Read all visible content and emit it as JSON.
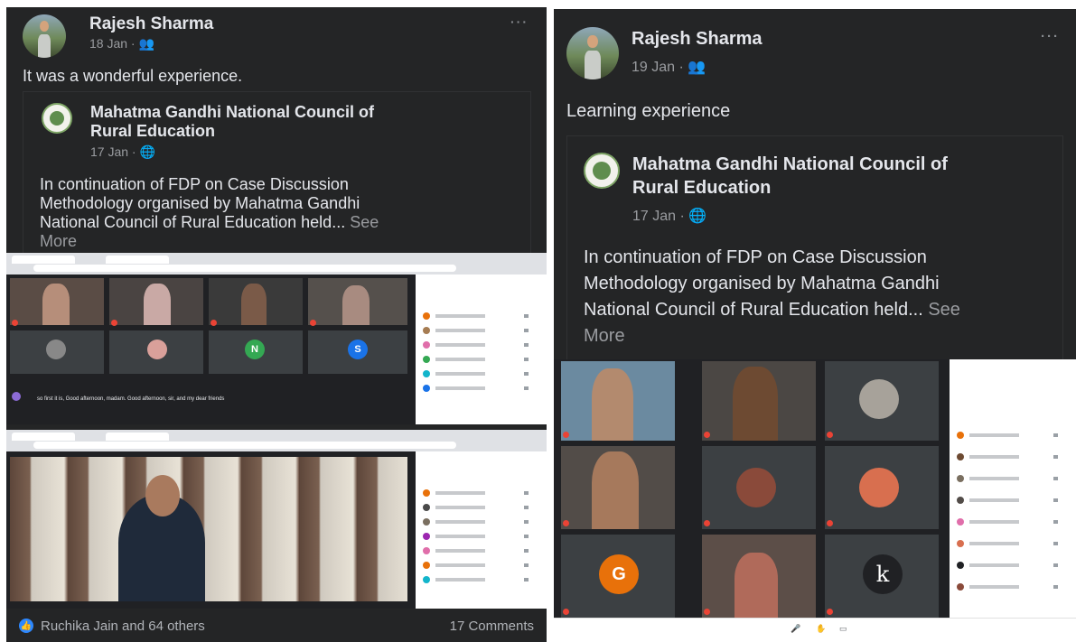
{
  "posts": [
    {
      "author": "Rajesh Sharma",
      "date": "18 Jan · ",
      "audience_icon": "friends-icon",
      "text": "It was a wonderful experience.",
      "shared": {
        "page_name_line1": "Mahatma Gandhi National Council of",
        "page_name_line2": "Rural Education",
        "date": "17 Jan · ",
        "audience_icon": "globe-icon",
        "body_line1": "In continuation of FDP on Case Discussion",
        "body_line2": "Methodology organised by Mahatma Gandhi",
        "body_line3": "National Council of Rural Education held... ",
        "see": "See",
        "more": "More"
      },
      "meeting1": {
        "letters": [
          "N",
          "S"
        ],
        "chat_text": "so first it is, Good afternoon, madam. Good afternoon, sir, and my dear friends"
      },
      "reactions": "Ruchika Jain and 64 others",
      "comments": "17 Comments"
    },
    {
      "author": "Rajesh Sharma",
      "date": "19 Jan · ",
      "audience_icon": "friends-icon",
      "text": "Learning experience",
      "shared": {
        "page_name_line1": "Mahatma Gandhi National Council of",
        "page_name_line2": "Rural Education",
        "date": "17 Jan · ",
        "audience_icon": "globe-icon",
        "body_line1": "In continuation of FDP on Case Discussion",
        "body_line2": "Methodology organised by Mahatma Gandhi",
        "body_line3": "National Council of Rural Education held... ",
        "see": "See",
        "more": "More"
      },
      "meeting": {
        "letters": [
          "G",
          "k"
        ]
      }
    }
  ],
  "colors": {
    "fb_dark": "#242526",
    "meet_dark": "#202124",
    "tile": "#3c4043",
    "mic_off": "#ea4335",
    "avatar_orange": "#e8710a",
    "avatar_green": "#34a853",
    "avatar_blue": "#1a73e8",
    "like_blue": "#2d88ff"
  }
}
